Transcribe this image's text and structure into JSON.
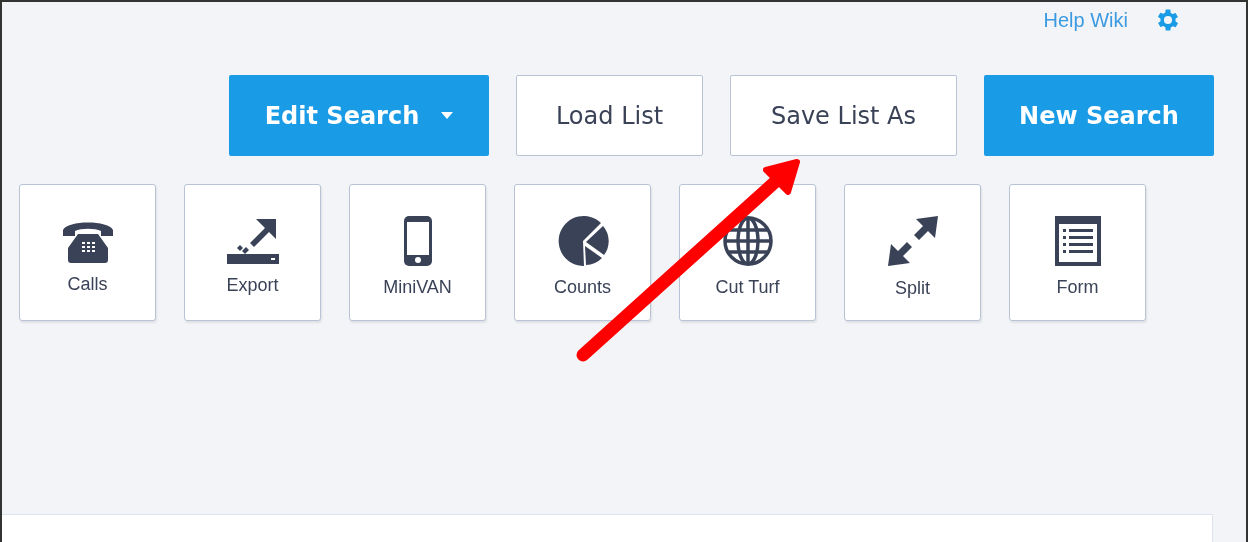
{
  "header": {
    "help_link": "Help Wiki"
  },
  "buttons": [
    {
      "label": "Edit Search",
      "kind": "primary",
      "dropdown": true
    },
    {
      "label": "Load List",
      "kind": "secondary",
      "dropdown": false
    },
    {
      "label": "Save List As",
      "kind": "secondary",
      "dropdown": false
    },
    {
      "label": "New Search",
      "kind": "primary",
      "dropdown": false
    }
  ],
  "tools": [
    {
      "label": "Calls"
    },
    {
      "label": "Export"
    },
    {
      "label": "MiniVAN"
    },
    {
      "label": "Counts"
    },
    {
      "label": "Cut Turf"
    },
    {
      "label": "Split"
    },
    {
      "label": "Form"
    }
  ]
}
